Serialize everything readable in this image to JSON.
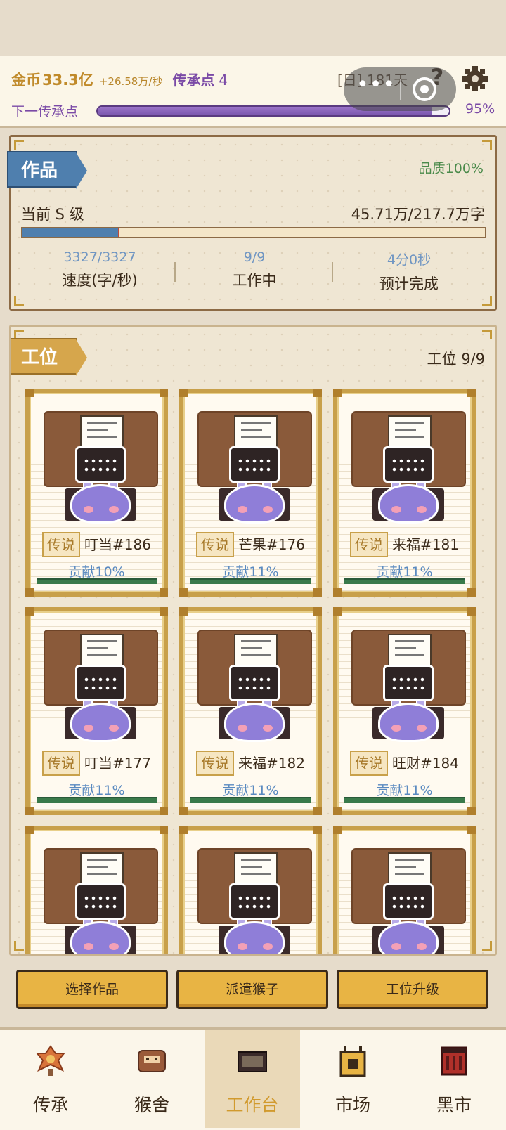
{
  "header": {
    "gold_label": "金币",
    "gold_value": "33.3亿",
    "gold_rate": "+26.58万/秒",
    "inherit_label": "传承点",
    "inherit_value": "4",
    "days": "[日] 181天",
    "help": "?",
    "next_label": "下一传承点",
    "next_progress": 0.95,
    "next_percent": "95%"
  },
  "work": {
    "tab": "作品",
    "quality": "品质100%",
    "grade": "当前 S 级",
    "progress_text": "45.71万/217.7万字",
    "progress": 0.21,
    "stats": [
      {
        "value": "3327/3327",
        "label": "速度(字/秒)"
      },
      {
        "value": "9/9",
        "label": "工作中"
      },
      {
        "value": "4分0秒",
        "label": "预计完成"
      }
    ]
  },
  "stations": {
    "tab": "工位",
    "count": "工位 9/9",
    "items": [
      {
        "rank": "传说",
        "name": "叮当#186",
        "contrib": "贡献10%"
      },
      {
        "rank": "传说",
        "name": "芒果#176",
        "contrib": "贡献11%"
      },
      {
        "rank": "传说",
        "name": "来福#181",
        "contrib": "贡献11%"
      },
      {
        "rank": "传说",
        "name": "叮当#177",
        "contrib": "贡献11%"
      },
      {
        "rank": "传说",
        "name": "来福#182",
        "contrib": "贡献11%"
      },
      {
        "rank": "传说",
        "name": "旺财#184",
        "contrib": "贡献11%"
      },
      {
        "rank": "",
        "name": "",
        "contrib": ""
      },
      {
        "rank": "",
        "name": "",
        "contrib": ""
      },
      {
        "rank": "",
        "name": "",
        "contrib": ""
      }
    ]
  },
  "actions": {
    "select": "选择作品",
    "dispatch": "派遣猴子",
    "upgrade": "工位升级"
  },
  "nav": [
    {
      "label": "传承",
      "icon": "inheritance-icon"
    },
    {
      "label": "猴舍",
      "icon": "monkey-house-icon"
    },
    {
      "label": "工作台",
      "icon": "workbench-icon"
    },
    {
      "label": "市场",
      "icon": "market-icon"
    },
    {
      "label": "黑市",
      "icon": "black-market-icon"
    }
  ],
  "colors": {
    "accent_gold": "#e8b444",
    "inherit_purple": "#7a4aa6",
    "work_blue": "#4f7fae",
    "active_nav": "#d19a2e"
  }
}
